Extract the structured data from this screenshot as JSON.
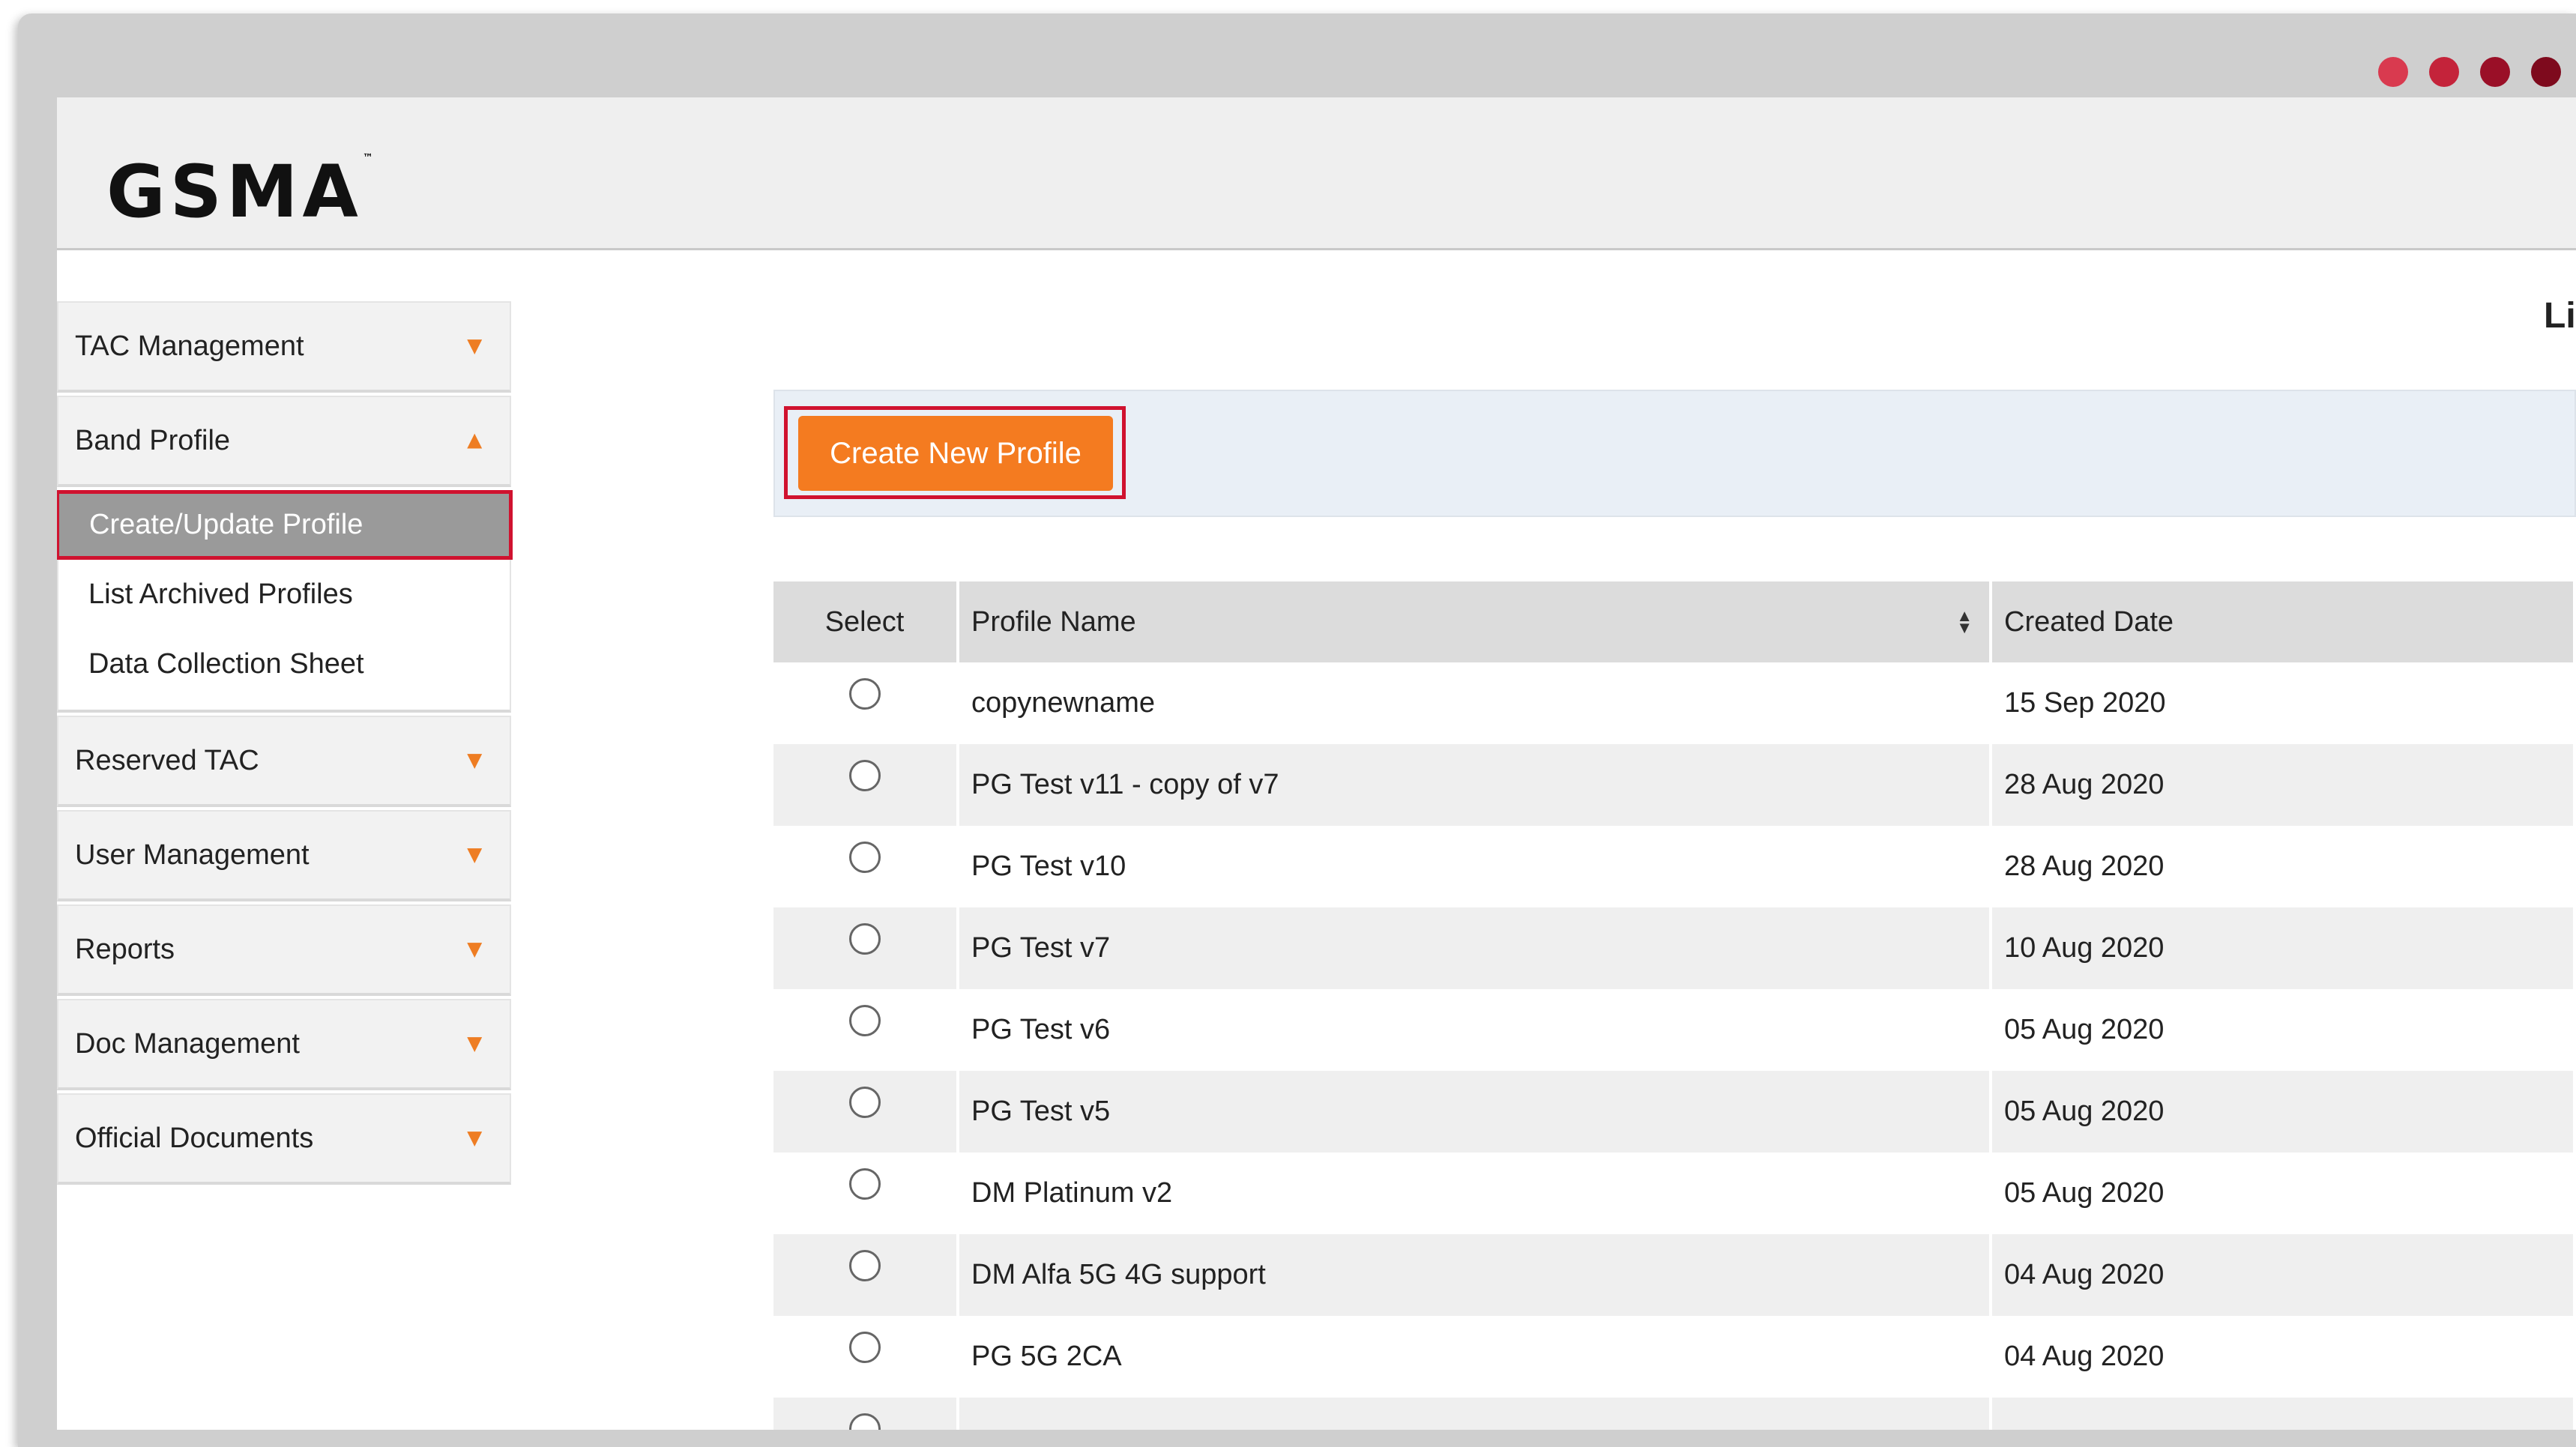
{
  "window": {
    "dot_colors": [
      "#d93a4f",
      "#c4233a",
      "#9a0f27",
      "#7e0a1d"
    ]
  },
  "header": {
    "logo_text": "GSMA",
    "logo_tm": "™"
  },
  "page": {
    "title": "Lis"
  },
  "sidebar": {
    "items": [
      {
        "label": "TAC Management",
        "arrow": "▼"
      },
      {
        "label": "Band Profile",
        "arrow": "▲"
      },
      {
        "label": "Reserved TAC",
        "arrow": "▼"
      },
      {
        "label": "User Management",
        "arrow": "▼"
      },
      {
        "label": "Reports",
        "arrow": "▼"
      },
      {
        "label": "Doc Management",
        "arrow": "▼"
      },
      {
        "label": "Official Documents",
        "arrow": "▼"
      }
    ],
    "band_profile_sub": [
      {
        "label": "Create/Update Profile"
      },
      {
        "label": "List Archived Profiles"
      },
      {
        "label": "Data Collection Sheet"
      }
    ]
  },
  "toolbar": {
    "create_label": "Create New Profile"
  },
  "table": {
    "headers": {
      "select": "Select",
      "profile_name": "Profile Name",
      "created_date": "Created Date"
    },
    "rows": [
      {
        "name": "copynewname",
        "date": "15 Sep 2020"
      },
      {
        "name": "PG Test v11 - copy of v7",
        "date": "28 Aug 2020"
      },
      {
        "name": "PG Test v10",
        "date": "28 Aug 2020"
      },
      {
        "name": "PG Test v7",
        "date": "10 Aug 2020"
      },
      {
        "name": "PG Test v6",
        "date": "05 Aug 2020"
      },
      {
        "name": "PG Test v5",
        "date": "05 Aug 2020"
      },
      {
        "name": "DM Platinum v2",
        "date": "05 Aug 2020"
      },
      {
        "name": "DM Alfa 5G 4G support",
        "date": "04 Aug 2020"
      },
      {
        "name": "PG 5G 2CA",
        "date": "04 Aug 2020"
      },
      {
        "name": "",
        "date": ""
      }
    ]
  },
  "colors": {
    "accent": "#f47b20",
    "highlight": "#d0122f"
  }
}
